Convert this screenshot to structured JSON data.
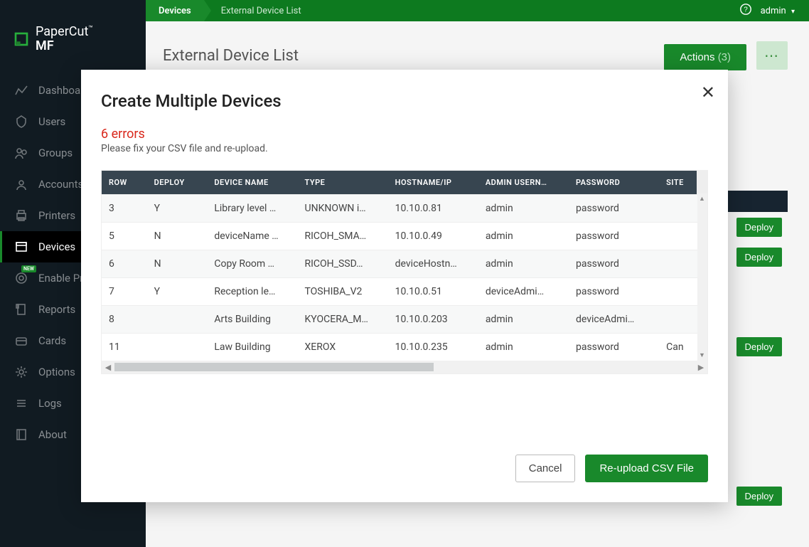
{
  "brand": {
    "name1": "PaperCut",
    "name2": "MF"
  },
  "nav": {
    "items": [
      {
        "label": "Dashboard"
      },
      {
        "label": "Users"
      },
      {
        "label": "Groups"
      },
      {
        "label": "Accounts"
      },
      {
        "label": "Printers"
      },
      {
        "label": "Devices"
      },
      {
        "label": "Enable Printing",
        "new": "NEW"
      },
      {
        "label": "Reports"
      },
      {
        "label": "Cards"
      },
      {
        "label": "Options"
      },
      {
        "label": "Logs"
      },
      {
        "label": "About"
      }
    ]
  },
  "breadcrumb": {
    "a": "Devices",
    "b": "External Device List"
  },
  "user": {
    "name": "admin"
  },
  "page": {
    "title": "External Device List",
    "actions_label": "Actions",
    "actions_count": "(3)"
  },
  "bg": {
    "deploy": "Deploy"
  },
  "modal": {
    "title": "Create Multiple Devices",
    "errors_title": "6 errors",
    "errors_sub": "Please fix your CSV file and re-upload.",
    "columns": {
      "row": "ROW",
      "deploy": "DEPLOY",
      "name": "DEVICE NAME",
      "type": "TYPE",
      "host": "HOSTNAME/IP",
      "user": "ADMIN USERN…",
      "pass": "PASSWORD",
      "site": "SITE"
    },
    "rows": [
      {
        "row": "3",
        "deploy": "Y",
        "name": "Library level …",
        "type": "UNKNOWN i…",
        "host": "10.10.0.81",
        "user": "admin",
        "pass": "password",
        "site": "",
        "err": {
          "type": true
        }
      },
      {
        "row": "5",
        "deploy": "N",
        "name": "deviceName …",
        "type": "RICOH_SMA…",
        "host": "10.10.0.49",
        "user": "admin",
        "pass": "password",
        "site": "",
        "err": {
          "name": true
        }
      },
      {
        "row": "6",
        "deploy": "N",
        "name": "Copy Room …",
        "type": "RICOH_SSD…",
        "host": "deviceHostn…",
        "user": "admin",
        "pass": "password",
        "site": "",
        "err": {
          "host": true
        }
      },
      {
        "row": "7",
        "deploy": "Y",
        "name": "Reception le…",
        "type": "TOSHIBA_V2",
        "host": "10.10.0.51",
        "user": "deviceAdmi…",
        "pass": "password",
        "site": "",
        "err": {
          "user": true
        }
      },
      {
        "row": "8",
        "deploy": "",
        "name": "Arts Building",
        "type": "KYOCERA_M…",
        "host": "10.10.0.203",
        "user": "admin",
        "pass": "deviceAdmi…",
        "site": "",
        "err": {
          "pass": true
        }
      },
      {
        "row": "11",
        "deploy": "",
        "name": "Law Building",
        "type": "XEROX",
        "host": "10.10.0.235",
        "user": "admin",
        "pass": "password",
        "site": "Can",
        "err": {
          "site": true
        }
      }
    ],
    "cancel": "Cancel",
    "reupload": "Re-upload CSV File"
  }
}
